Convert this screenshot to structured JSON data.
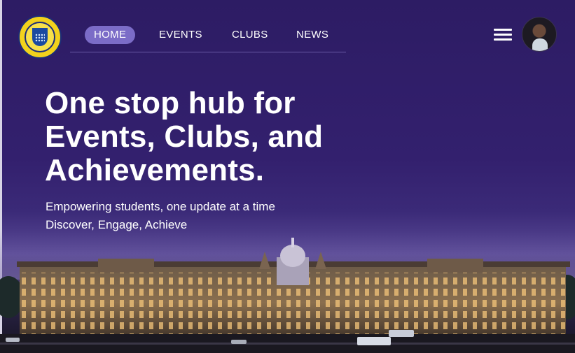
{
  "nav": {
    "items": [
      "HOME",
      "EVENTS",
      "CLUBS",
      "NEWS"
    ],
    "active": "HOME"
  },
  "hero": {
    "headline_lines": [
      "One stop hub for",
      "Events, Clubs, and",
      "Achievements."
    ],
    "subline1": "Empowering students, one update at a time",
    "subline2": "Discover, Engage, Achieve"
  },
  "icons": {
    "menu": "hamburger-menu-icon",
    "profile": "user-avatar"
  },
  "colors": {
    "background": "#2e1c66",
    "active_pill": "#7b6cc7",
    "text": "#ffffff"
  }
}
